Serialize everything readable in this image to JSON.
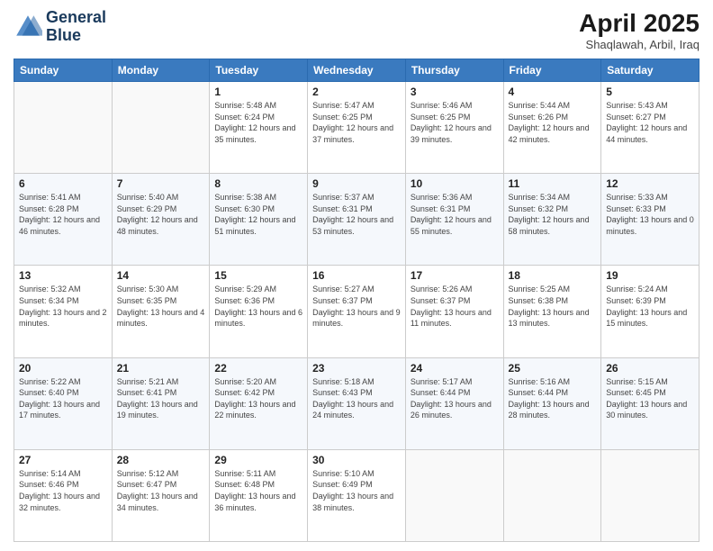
{
  "header": {
    "logo_line1": "General",
    "logo_line2": "Blue",
    "main_title": "April 2025",
    "subtitle": "Shaqlawah, Arbil, Iraq"
  },
  "weekdays": [
    "Sunday",
    "Monday",
    "Tuesday",
    "Wednesday",
    "Thursday",
    "Friday",
    "Saturday"
  ],
  "weeks": [
    [
      {
        "day": "",
        "sunrise": "",
        "sunset": "",
        "daylight": ""
      },
      {
        "day": "",
        "sunrise": "",
        "sunset": "",
        "daylight": ""
      },
      {
        "day": "1",
        "sunrise": "Sunrise: 5:48 AM",
        "sunset": "Sunset: 6:24 PM",
        "daylight": "Daylight: 12 hours and 35 minutes."
      },
      {
        "day": "2",
        "sunrise": "Sunrise: 5:47 AM",
        "sunset": "Sunset: 6:25 PM",
        "daylight": "Daylight: 12 hours and 37 minutes."
      },
      {
        "day": "3",
        "sunrise": "Sunrise: 5:46 AM",
        "sunset": "Sunset: 6:25 PM",
        "daylight": "Daylight: 12 hours and 39 minutes."
      },
      {
        "day": "4",
        "sunrise": "Sunrise: 5:44 AM",
        "sunset": "Sunset: 6:26 PM",
        "daylight": "Daylight: 12 hours and 42 minutes."
      },
      {
        "day": "5",
        "sunrise": "Sunrise: 5:43 AM",
        "sunset": "Sunset: 6:27 PM",
        "daylight": "Daylight: 12 hours and 44 minutes."
      }
    ],
    [
      {
        "day": "6",
        "sunrise": "Sunrise: 5:41 AM",
        "sunset": "Sunset: 6:28 PM",
        "daylight": "Daylight: 12 hours and 46 minutes."
      },
      {
        "day": "7",
        "sunrise": "Sunrise: 5:40 AM",
        "sunset": "Sunset: 6:29 PM",
        "daylight": "Daylight: 12 hours and 48 minutes."
      },
      {
        "day": "8",
        "sunrise": "Sunrise: 5:38 AM",
        "sunset": "Sunset: 6:30 PM",
        "daylight": "Daylight: 12 hours and 51 minutes."
      },
      {
        "day": "9",
        "sunrise": "Sunrise: 5:37 AM",
        "sunset": "Sunset: 6:31 PM",
        "daylight": "Daylight: 12 hours and 53 minutes."
      },
      {
        "day": "10",
        "sunrise": "Sunrise: 5:36 AM",
        "sunset": "Sunset: 6:31 PM",
        "daylight": "Daylight: 12 hours and 55 minutes."
      },
      {
        "day": "11",
        "sunrise": "Sunrise: 5:34 AM",
        "sunset": "Sunset: 6:32 PM",
        "daylight": "Daylight: 12 hours and 58 minutes."
      },
      {
        "day": "12",
        "sunrise": "Sunrise: 5:33 AM",
        "sunset": "Sunset: 6:33 PM",
        "daylight": "Daylight: 13 hours and 0 minutes."
      }
    ],
    [
      {
        "day": "13",
        "sunrise": "Sunrise: 5:32 AM",
        "sunset": "Sunset: 6:34 PM",
        "daylight": "Daylight: 13 hours and 2 minutes."
      },
      {
        "day": "14",
        "sunrise": "Sunrise: 5:30 AM",
        "sunset": "Sunset: 6:35 PM",
        "daylight": "Daylight: 13 hours and 4 minutes."
      },
      {
        "day": "15",
        "sunrise": "Sunrise: 5:29 AM",
        "sunset": "Sunset: 6:36 PM",
        "daylight": "Daylight: 13 hours and 6 minutes."
      },
      {
        "day": "16",
        "sunrise": "Sunrise: 5:27 AM",
        "sunset": "Sunset: 6:37 PM",
        "daylight": "Daylight: 13 hours and 9 minutes."
      },
      {
        "day": "17",
        "sunrise": "Sunrise: 5:26 AM",
        "sunset": "Sunset: 6:37 PM",
        "daylight": "Daylight: 13 hours and 11 minutes."
      },
      {
        "day": "18",
        "sunrise": "Sunrise: 5:25 AM",
        "sunset": "Sunset: 6:38 PM",
        "daylight": "Daylight: 13 hours and 13 minutes."
      },
      {
        "day": "19",
        "sunrise": "Sunrise: 5:24 AM",
        "sunset": "Sunset: 6:39 PM",
        "daylight": "Daylight: 13 hours and 15 minutes."
      }
    ],
    [
      {
        "day": "20",
        "sunrise": "Sunrise: 5:22 AM",
        "sunset": "Sunset: 6:40 PM",
        "daylight": "Daylight: 13 hours and 17 minutes."
      },
      {
        "day": "21",
        "sunrise": "Sunrise: 5:21 AM",
        "sunset": "Sunset: 6:41 PM",
        "daylight": "Daylight: 13 hours and 19 minutes."
      },
      {
        "day": "22",
        "sunrise": "Sunrise: 5:20 AM",
        "sunset": "Sunset: 6:42 PM",
        "daylight": "Daylight: 13 hours and 22 minutes."
      },
      {
        "day": "23",
        "sunrise": "Sunrise: 5:18 AM",
        "sunset": "Sunset: 6:43 PM",
        "daylight": "Daylight: 13 hours and 24 minutes."
      },
      {
        "day": "24",
        "sunrise": "Sunrise: 5:17 AM",
        "sunset": "Sunset: 6:44 PM",
        "daylight": "Daylight: 13 hours and 26 minutes."
      },
      {
        "day": "25",
        "sunrise": "Sunrise: 5:16 AM",
        "sunset": "Sunset: 6:44 PM",
        "daylight": "Daylight: 13 hours and 28 minutes."
      },
      {
        "day": "26",
        "sunrise": "Sunrise: 5:15 AM",
        "sunset": "Sunset: 6:45 PM",
        "daylight": "Daylight: 13 hours and 30 minutes."
      }
    ],
    [
      {
        "day": "27",
        "sunrise": "Sunrise: 5:14 AM",
        "sunset": "Sunset: 6:46 PM",
        "daylight": "Daylight: 13 hours and 32 minutes."
      },
      {
        "day": "28",
        "sunrise": "Sunrise: 5:12 AM",
        "sunset": "Sunset: 6:47 PM",
        "daylight": "Daylight: 13 hours and 34 minutes."
      },
      {
        "day": "29",
        "sunrise": "Sunrise: 5:11 AM",
        "sunset": "Sunset: 6:48 PM",
        "daylight": "Daylight: 13 hours and 36 minutes."
      },
      {
        "day": "30",
        "sunrise": "Sunrise: 5:10 AM",
        "sunset": "Sunset: 6:49 PM",
        "daylight": "Daylight: 13 hours and 38 minutes."
      },
      {
        "day": "",
        "sunrise": "",
        "sunset": "",
        "daylight": ""
      },
      {
        "day": "",
        "sunrise": "",
        "sunset": "",
        "daylight": ""
      },
      {
        "day": "",
        "sunrise": "",
        "sunset": "",
        "daylight": ""
      }
    ]
  ]
}
